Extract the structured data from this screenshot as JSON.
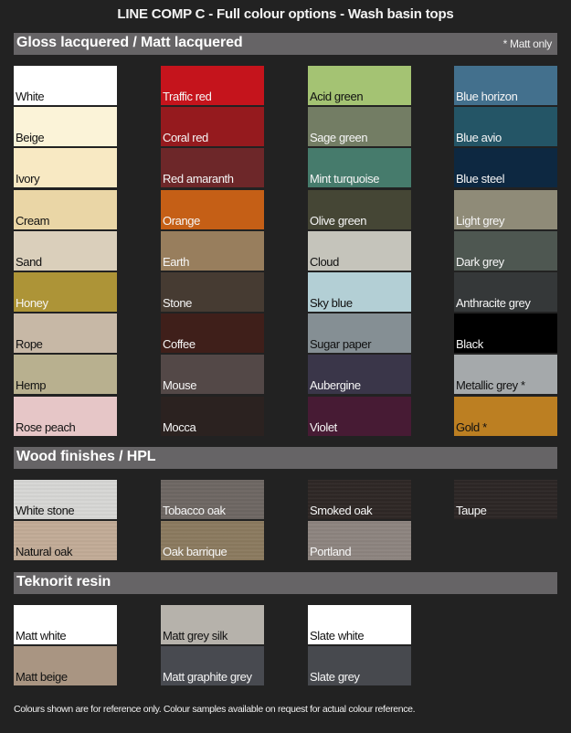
{
  "title": "LINE COMP C - Full colour options - Wash basin tops",
  "sections": {
    "gloss": {
      "title": "Gloss lacquered / Matt lacquered",
      "note": "* Matt only",
      "columns": [
        [
          {
            "label": "White",
            "color": "#ffffff",
            "text": "dark"
          },
          {
            "label": "Beige",
            "color": "#fbf3d8",
            "text": "dark"
          },
          {
            "label": "Ivory",
            "color": "#f8e9c3",
            "text": "dark"
          },
          {
            "label": "Cream",
            "color": "#ead6a6",
            "text": "dark"
          },
          {
            "label": "Sand",
            "color": "#dacfbb",
            "text": "dark"
          },
          {
            "label": "Honey",
            "color": "#ad9437",
            "text": "light"
          },
          {
            "label": "Rope",
            "color": "#c7b8a6",
            "text": "dark"
          },
          {
            "label": "Hemp",
            "color": "#b8b08f",
            "text": "dark"
          },
          {
            "label": "Rose peach",
            "color": "#e6c6c7",
            "text": "dark"
          }
        ],
        [
          {
            "label": "Traffic red",
            "color": "#c5141c",
            "text": "light"
          },
          {
            "label": "Coral red",
            "color": "#951a1e",
            "text": "light"
          },
          {
            "label": "Red amaranth",
            "color": "#6d2729",
            "text": "light"
          },
          {
            "label": "Orange",
            "color": "#c55f16",
            "text": "light"
          },
          {
            "label": "Earth",
            "color": "#987e5d",
            "text": "light"
          },
          {
            "label": "Stone",
            "color": "#463b32",
            "text": "light"
          },
          {
            "label": "Coffee",
            "color": "#3f1f1a",
            "text": "light"
          },
          {
            "label": "Mouse",
            "color": "#534847",
            "text": "light"
          },
          {
            "label": "Mocca",
            "color": "#2b2220",
            "text": "light"
          }
        ],
        [
          {
            "label": "Acid green",
            "color": "#a4c373",
            "text": "dark"
          },
          {
            "label": "Sage green",
            "color": "#737d64",
            "text": "light"
          },
          {
            "label": "Mint turquoise",
            "color": "#467b6c",
            "text": "light"
          },
          {
            "label": "Olive green",
            "color": "#454635",
            "text": "light"
          },
          {
            "label": "Cloud",
            "color": "#c5c4bb",
            "text": "dark"
          },
          {
            "label": "Sky blue",
            "color": "#b3cfd5",
            "text": "dark"
          },
          {
            "label": "Sugar paper",
            "color": "#858f94",
            "text": "dark"
          },
          {
            "label": "Aubergine",
            "color": "#3a3649",
            "text": "light"
          },
          {
            "label": "Violet",
            "color": "#471b34",
            "text": "light"
          }
        ],
        [
          {
            "label": "Blue horizon",
            "color": "#43708d",
            "text": "light"
          },
          {
            "label": "Blue avio",
            "color": "#245566",
            "text": "light"
          },
          {
            "label": "Blue steel",
            "color": "#0d2841",
            "text": "light"
          },
          {
            "label": "Light grey",
            "color": "#8f8b78",
            "text": "light"
          },
          {
            "label": "Dark grey",
            "color": "#4e5751",
            "text": "light"
          },
          {
            "label": "Anthracite grey",
            "color": "#353839",
            "text": "light"
          },
          {
            "label": "Black",
            "color": "#000000",
            "text": "light"
          },
          {
            "label": "Metallic grey *",
            "color": "#a5a9ab",
            "text": "dark"
          },
          {
            "label": "Gold *",
            "color": "#bc7f22",
            "text": "dark"
          }
        ]
      ]
    },
    "wood": {
      "title": "Wood finishes / HPL",
      "columns": [
        [
          {
            "label": "White stone",
            "color": "#d9d9d7",
            "text": "dark"
          },
          {
            "label": "Natural oak",
            "color": "#c4ad98",
            "text": "dark"
          }
        ],
        [
          {
            "label": "Tobacco oak",
            "color": "#6e6763",
            "text": "light"
          },
          {
            "label": "Oak barrique",
            "color": "#8c7b5f",
            "text": "light"
          }
        ],
        [
          {
            "label": "Smoked oak",
            "color": "#2d2624",
            "text": "light"
          },
          {
            "label": "Portland",
            "color": "#8e8580",
            "text": "light"
          }
        ],
        [
          {
            "label": "Taupe",
            "color": "#2b2524",
            "text": "light"
          }
        ]
      ]
    },
    "resin": {
      "title": "Teknorit resin",
      "columns": [
        [
          {
            "label": "Matt white",
            "color": "#ffffff",
            "text": "dark"
          },
          {
            "label": "Matt beige",
            "color": "#a99582",
            "text": "dark"
          }
        ],
        [
          {
            "label": "Matt grey silk",
            "color": "#b6b2ab",
            "text": "dark"
          },
          {
            "label": "Matt graphite grey",
            "color": "#484a50",
            "text": "light"
          }
        ],
        [
          {
            "label": "Slate white",
            "color": "#ffffff",
            "text": "dark"
          },
          {
            "label": "Slate grey",
            "color": "#47494e",
            "text": "light"
          }
        ]
      ]
    }
  },
  "footnote": "Colours shown are for reference only. Colour samples available on request for actual colour reference."
}
